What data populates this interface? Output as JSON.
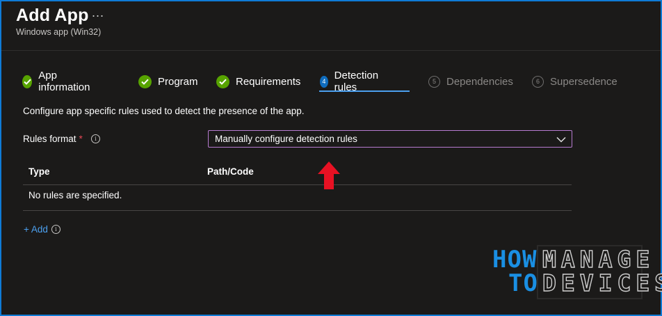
{
  "header": {
    "title": "Add App",
    "more": "...",
    "subtitle": "Windows app (Win32)"
  },
  "tabs": [
    {
      "label": "App information",
      "state": "complete"
    },
    {
      "label": "Program",
      "state": "complete"
    },
    {
      "label": "Requirements",
      "state": "complete"
    },
    {
      "label": "Detection rules",
      "state": "active",
      "number": "4"
    },
    {
      "label": "Dependencies",
      "state": "disabled",
      "number": "5"
    },
    {
      "label": "Supersedence",
      "state": "disabled",
      "number": "6"
    }
  ],
  "main": {
    "description": "Configure app specific rules used to detect the presence of the app.",
    "rules_format_label": "Rules format",
    "required_mark": "*",
    "info_glyph": "i",
    "rules_format_value": "Manually configure detection rules",
    "table": {
      "columns": [
        "Type",
        "Path/Code"
      ],
      "empty_text": "No rules are specified."
    },
    "add_label": "+ Add"
  },
  "logo": {
    "line1_left": "HOW",
    "line1_right": "MANAGE",
    "line2_left": "TO",
    "line2_right": "DEVICES"
  },
  "colors": {
    "accent": "#0f6cbd",
    "link": "#4ca0ef",
    "complete": "#57a300",
    "required": "#e74856",
    "annotation_arrow": "#e81123",
    "select_border": "#b77bd0"
  },
  "icons": {
    "complete": "check-circle-icon",
    "info": "info-icon",
    "chevron": "chevron-down-icon",
    "annotation": "red-up-arrow-icon"
  }
}
